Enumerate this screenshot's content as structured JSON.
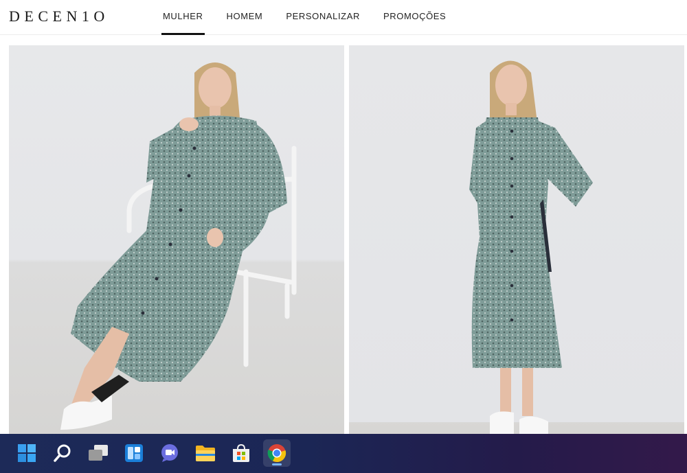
{
  "brand": {
    "logo_text": "DECEN1O"
  },
  "nav": {
    "items": [
      {
        "label": "MULHER",
        "active": true
      },
      {
        "label": "HOMEM",
        "active": false
      },
      {
        "label": "PERSONALIZAR",
        "active": false
      },
      {
        "label": "PROMOÇÕES",
        "active": false
      }
    ]
  },
  "product": {
    "photos": [
      {
        "alt_icon": "product-photo-seated"
      },
      {
        "alt_icon": "product-photo-standing"
      }
    ],
    "colors": {
      "dress": "#7f9c98",
      "dress_dark": "#5f7a77",
      "backdrop": "#e6e7e9",
      "floor": "#d6d5d3"
    }
  },
  "taskbar": {
    "icons": [
      {
        "name": "windows-start-icon"
      },
      {
        "name": "search-icon"
      },
      {
        "name": "task-view-icon"
      },
      {
        "name": "widgets-icon"
      },
      {
        "name": "chat-icon"
      },
      {
        "name": "file-explorer-icon"
      },
      {
        "name": "store-icon"
      },
      {
        "name": "chrome-icon",
        "active": true
      }
    ]
  }
}
